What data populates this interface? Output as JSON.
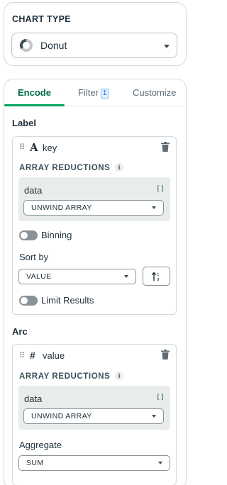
{
  "chart_type": {
    "title": "CHART TYPE",
    "selected": "Donut",
    "icon": "donut-chart-icon"
  },
  "tabs": [
    {
      "label": "Encode",
      "active": true
    },
    {
      "label": "Filter",
      "badge": "1",
      "active": false
    },
    {
      "label": "Customize",
      "active": false
    }
  ],
  "label_section": {
    "heading": "Label",
    "field": {
      "type_icon": "A",
      "name": "key"
    },
    "array_reductions_heading": "ARRAY REDUCTIONS",
    "reduction": {
      "field": "data",
      "bracket": "[]",
      "value": "UNWIND ARRAY"
    },
    "binning_label": "Binning",
    "binning_on": false,
    "sort_by_label": "Sort by",
    "sort_by_value": "VALUE",
    "sort_direction_icon": "sort-ascending-icon",
    "limit_label": "Limit Results",
    "limit_on": false
  },
  "arc_section": {
    "heading": "Arc",
    "field": {
      "type_icon": "#",
      "name": "value"
    },
    "array_reductions_heading": "ARRAY REDUCTIONS",
    "reduction": {
      "field": "data",
      "bracket": "[]",
      "value": "UNWIND ARRAY"
    },
    "aggregate_label": "Aggregate",
    "aggregate_value": "SUM"
  },
  "colors": {
    "accent_green": "#00684a",
    "tab_underline": "#00a35c",
    "border": "#d4d9dd"
  }
}
